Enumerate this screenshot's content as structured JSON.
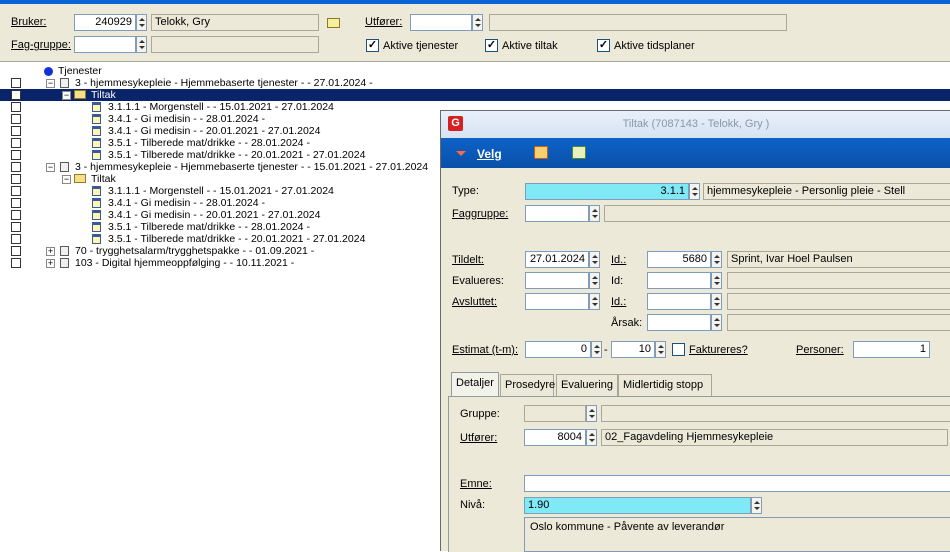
{
  "filter": {
    "bruker_label": "Bruker:",
    "bruker_id": "240929",
    "bruker_name": "Telokk, Gry",
    "faggruppe_label": "Fag-gruppe:",
    "faggruppe_value": "",
    "faggruppe_name": "",
    "utforer_label": "Utfører:",
    "utforer_value": "",
    "utforer_name": "",
    "aktive_tjenester_label": "Aktive tjenester",
    "aktive_tiltak_label": "Aktive tiltak",
    "aktive_tidsplaner_label": "Aktive tidsplaner",
    "check_mark": "✓"
  },
  "tree": {
    "root": "Tjenester",
    "rows": [
      {
        "label": "3 - hjemmesykepleie - Hjemmebaserte tjenester - - 27.01.2024 -"
      },
      {
        "label": "Tiltak"
      },
      {
        "label": "3.1.1.1 - Morgenstell - - 15.01.2021 - 27.01.2024"
      },
      {
        "label": "3.4.1 - Gi medisin - - 28.01.2024 -"
      },
      {
        "label": "3.4.1 - Gi medisin - - 20.01.2021 - 27.01.2024"
      },
      {
        "label": "3.5.1 - Tilberede mat/drikke - - 28.01.2024 -"
      },
      {
        "label": "3.5.1 - Tilberede mat/drikke - - 20.01.2021 - 27.01.2024"
      },
      {
        "label": "3 - hjemmesykepleie - Hjemmebaserte tjenester - - 15.01.2021 - 27.01.2024"
      },
      {
        "label": "Tiltak"
      },
      {
        "label": "3.1.1.1 - Morgenstell - - 15.01.2021 - 27.01.2024"
      },
      {
        "label": "3.4.1 - Gi medisin - - 28.01.2024 -"
      },
      {
        "label": "3.4.1 - Gi medisin - - 20.01.2021 - 27.01.2024"
      },
      {
        "label": "3.5.1 - Tilberede mat/drikke - - 28.01.2024 -"
      },
      {
        "label": "3.5.1 - Tilberede mat/drikke - - 20.01.2021 - 27.01.2024"
      },
      {
        "label": "70 - trygghetsalarm/trygghetspakke - - 01.09.2021 -"
      },
      {
        "label": "103 - Digital hjemmeoppfølging - - 10.11.2021 -"
      }
    ],
    "expander_minus": "−",
    "expander_plus": "+"
  },
  "dialog": {
    "title": "Tiltak (7087143 - Telokk, Gry )",
    "logo": "G",
    "velg_label": "Velg",
    "type_label": "Type:",
    "type_code": "3.1.1",
    "type_name": "hjemmesykepleie - Personlig pleie - Stell",
    "faggruppe_label": "Faggruppe:",
    "tildelt_label": "Tildelt:",
    "tildelt_date": "27.01.2024",
    "id_label": "Id.:",
    "tildelt_id": "5680",
    "tildelt_person": "Sprint, Ivar Hoel  Paulsen",
    "evalueres_label": "Evalueres:",
    "id2_label": "Id:",
    "avsluttet_label": "Avsluttet:",
    "id3_label": "Id.:",
    "arsak_label": "Årsak:",
    "estimat_label": "Estimat (t-m):",
    "estimat_hours": "0",
    "estimat_minutes": "10",
    "dash": "-",
    "faktureres_label": "Faktureres?",
    "personer_label": "Personer:",
    "personer_value": "1",
    "tabs": [
      "Detaljer",
      "Prosedyre",
      "Evaluering",
      "Midlertidig stopp"
    ],
    "gruppe_label": "Gruppe:",
    "utforer_label": "Utfører:",
    "utforer_id": "8004",
    "utforer_name": "02_Fagavdeling Hjemmesykepleie",
    "emne_label": "Emne:",
    "niva_label": "Nivå:",
    "niva_value": "1.90",
    "note": "Oslo kommune - Påvente av leverandør"
  },
  "colors": {
    "selection": "#0a246a",
    "toolbar": "#0d62c8",
    "highlight_field": "#7fe9f5"
  }
}
